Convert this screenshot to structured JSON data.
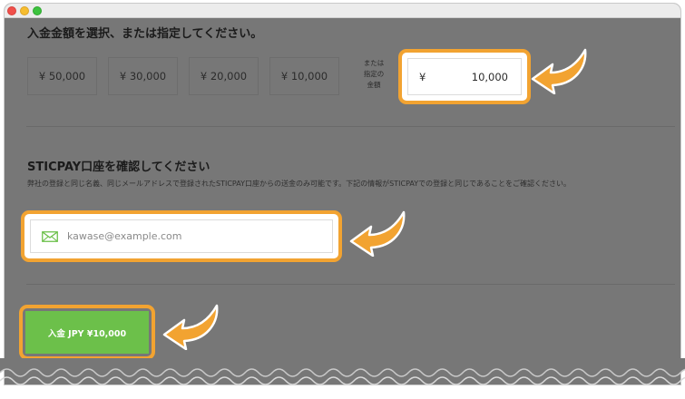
{
  "window": {
    "controls": [
      "close",
      "minimize",
      "maximize"
    ]
  },
  "amount_section": {
    "heading": "入金金額を選択、または指定してください。",
    "presets": [
      "¥ 50,000",
      "¥ 30,000",
      "¥ 20,000",
      "¥ 10,000"
    ],
    "or_label": [
      "または",
      "指定の",
      "金額"
    ],
    "custom_amount": {
      "currency": "¥",
      "value": "10,000"
    }
  },
  "account_section": {
    "heading": "STICPAY口座を確認してください",
    "note": "弊社の登録と同じ名義、同じメールアドレスで登録されたSTICPAY口座からの送金のみ可能です。下記の情報がSTICPAYでの登録と同じであることをご確認ください。",
    "email_placeholder": "kawase@example.com"
  },
  "submit": {
    "label": "入金 JPY ¥10,000"
  },
  "colors": {
    "highlight": "#f2a331",
    "button": "#6cc04a",
    "overlay": "#777777"
  }
}
